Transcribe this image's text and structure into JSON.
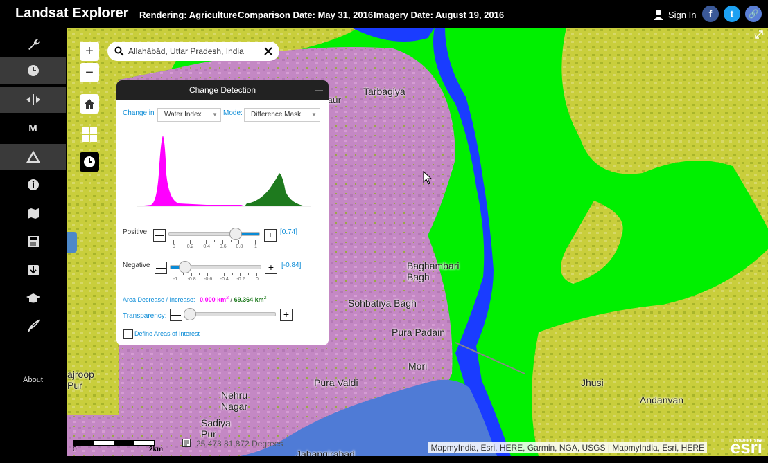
{
  "header": {
    "title": "Landsat Explorer",
    "rendering": "Rendering: Agriculture",
    "comparison_date": "Comparison Date: May 31, 2016",
    "imagery_date": "Imagery Date: August 19, 2016",
    "sign_in": "Sign In"
  },
  "social": {
    "facebook": "f",
    "twitter": "t",
    "link": "🔗"
  },
  "sidebar": {
    "about": "About"
  },
  "map": {
    "zoom_in": "+",
    "zoom_out": "−",
    "search_value": "Allahābād, Uttar Pradesh, India",
    "coords": "25.473  81.872 Degrees",
    "scale_start": "0",
    "scale_end": "2km",
    "attribution": "MapmyIndia, Esri, HERE, Garmin, NGA, USGS | MapmyIndia, Esri, HERE",
    "esri_powered": "POWERED BY",
    "esri": "esri",
    "places": [
      "Tarbagiya",
      "Baghambari Bagh",
      "Sohbatiya Bagh",
      "Pura Padain",
      "Mori",
      "Pura Valdi",
      "Nehru Nagar",
      "Sadiya Pur",
      "Jahangirabad",
      "ajroop Pur",
      "Jhusi",
      "Andanvan",
      "aur"
    ]
  },
  "panel": {
    "title": "Change Detection",
    "minimize": "—",
    "change_in_label": "Change in",
    "change_in_value": "Water Index",
    "mode_label": "Mode:",
    "mode_value": "Difference Mask",
    "positive_label": "Positive",
    "positive_value": "[0.74]",
    "positive_level": 0.74,
    "positive_ticks": [
      "0",
      "0.2",
      "0.4",
      "0.6",
      "0.8",
      "1"
    ],
    "negative_label": "Negative",
    "negative_value": "[-0.84]",
    "negative_level": -0.84,
    "negative_ticks": [
      "-1",
      "-0.8",
      "-0.6",
      "-0.4",
      "-0.2",
      "0"
    ],
    "area_label": "Area Decrease / Increase:",
    "area_decrease": "0.000 km",
    "area_increase": "69.364 km",
    "sup": "2",
    "sep": "/",
    "transparency_label": "Transparency:",
    "aoi_label": "Define Areas of Interest",
    "plus": "+",
    "minus": "—"
  },
  "colors": {
    "mask": "#00f000",
    "decrease": "#ff00ff",
    "increase": "#1e7a1e",
    "water": "#1a3cff",
    "accent": "#0a8bd6"
  }
}
